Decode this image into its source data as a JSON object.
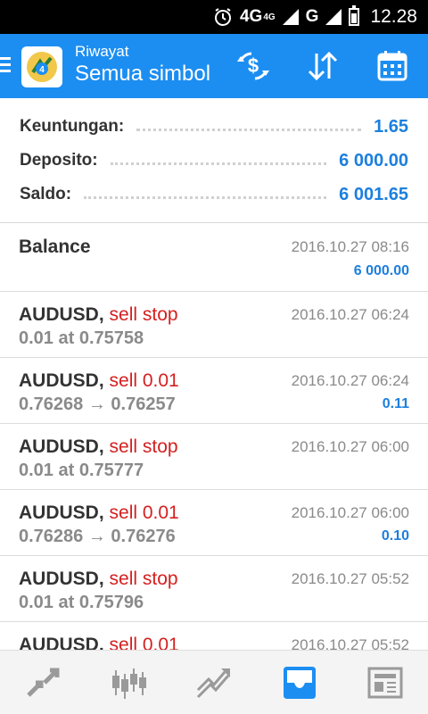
{
  "status_bar": {
    "network": "4G",
    "network_sup": "4G",
    "network2": "G",
    "time": "12.28",
    "icons": [
      "alarm-icon",
      "signal-icon",
      "signal-icon",
      "battery-icon"
    ]
  },
  "app_bar": {
    "subtitle": "Riwayat",
    "title": "Semua simbol",
    "accent": "#1c8ef2",
    "actions": [
      "currency-swap-icon",
      "sort-icon",
      "calendar-icon"
    ]
  },
  "summary": {
    "rows": [
      {
        "label": "Keuntungan:",
        "value": "1.65"
      },
      {
        "label": "Deposito:",
        "value": "6 000.00"
      },
      {
        "label": "Saldo:",
        "value": "6 001.65"
      }
    ]
  },
  "history": [
    {
      "title": "Balance",
      "symbol": "",
      "action": "",
      "sub": "",
      "date": "2016.10.27 08:16",
      "profit": "6 000.00"
    },
    {
      "title": "",
      "symbol": "AUDUSD,",
      "action": "sell stop",
      "sub": "0.01 at 0.75758",
      "date": "2016.10.27 06:24",
      "profit": ""
    },
    {
      "title": "",
      "symbol": "AUDUSD,",
      "action": "sell 0.01",
      "sub": "0.76268 → 0.76257",
      "date": "2016.10.27 06:24",
      "profit": "0.11"
    },
    {
      "title": "",
      "symbol": "AUDUSD,",
      "action": "sell stop",
      "sub": "0.01 at 0.75777",
      "date": "2016.10.27 06:00",
      "profit": ""
    },
    {
      "title": "",
      "symbol": "AUDUSD,",
      "action": "sell 0.01",
      "sub": "0.76286 → 0.76276",
      "date": "2016.10.27 06:00",
      "profit": "0.10"
    },
    {
      "title": "",
      "symbol": "AUDUSD,",
      "action": "sell stop",
      "sub": "0.01 at 0.75796",
      "date": "2016.10.27 05:52",
      "profit": ""
    },
    {
      "title": "",
      "symbol": "AUDUSD,",
      "action": "sell 0.01",
      "sub": "",
      "date": "2016.10.27 05:52",
      "profit": ""
    }
  ],
  "bottom_nav": {
    "items": [
      "quotes-icon",
      "chart-icon",
      "trade-icon",
      "history-icon",
      "news-icon"
    ],
    "active_index": 3,
    "active_color": "#1c8ef2",
    "inactive_color": "#9a9a9a"
  }
}
